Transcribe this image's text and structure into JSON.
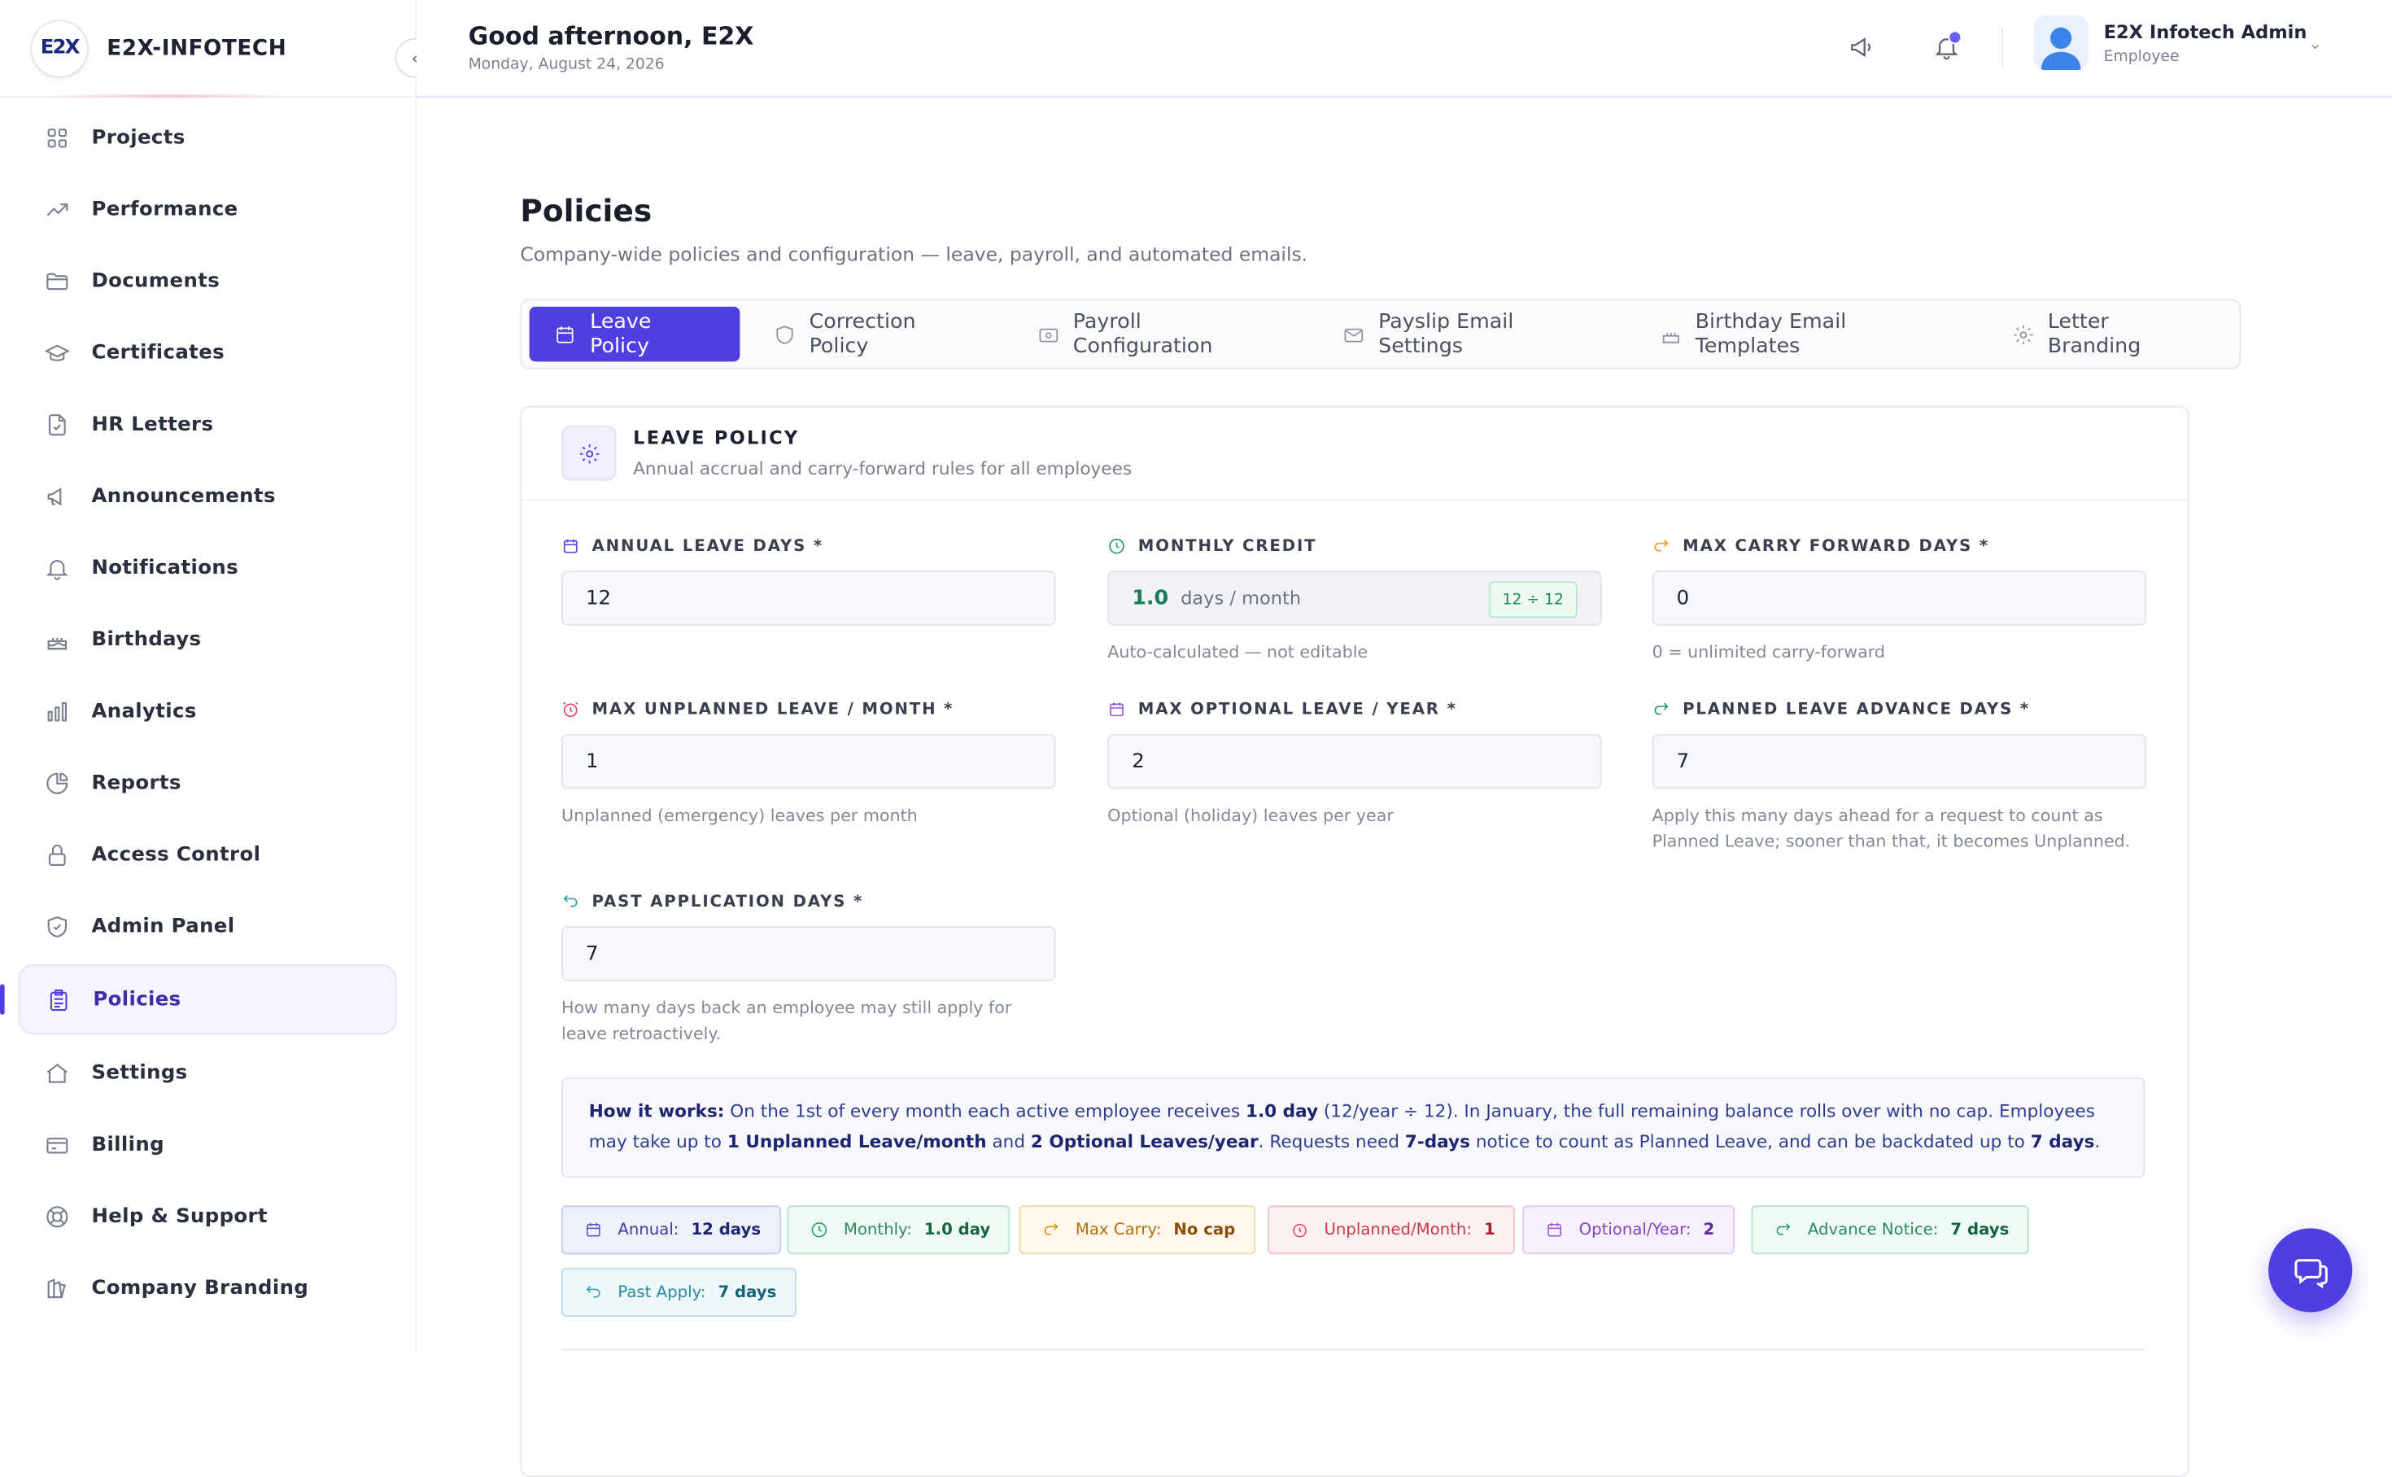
{
  "brand": {
    "name": "E2X-INFOTECH",
    "logo_text": "E2X"
  },
  "sidebar": {
    "items": [
      {
        "label": "Projects",
        "icon": "grid-icon"
      },
      {
        "label": "Performance",
        "icon": "trend-icon"
      },
      {
        "label": "Documents",
        "icon": "folder-icon"
      },
      {
        "label": "Certificates",
        "icon": "graduation-cap-icon"
      },
      {
        "label": "HR Letters",
        "icon": "file-check-icon"
      },
      {
        "label": "Announcements",
        "icon": "megaphone-icon"
      },
      {
        "label": "Notifications",
        "icon": "bell-icon"
      },
      {
        "label": "Birthdays",
        "icon": "cake-icon"
      },
      {
        "label": "Analytics",
        "icon": "bar-chart-icon"
      },
      {
        "label": "Reports",
        "icon": "pie-chart-icon"
      },
      {
        "label": "Access Control",
        "icon": "lock-icon"
      },
      {
        "label": "Admin Panel",
        "icon": "shield-check-icon"
      },
      {
        "label": "Policies",
        "icon": "clipboard-icon",
        "active": true
      },
      {
        "label": "Settings",
        "icon": "home-icon"
      },
      {
        "label": "Billing",
        "icon": "credit-card-icon"
      },
      {
        "label": "Help & Support",
        "icon": "lifebuoy-icon"
      },
      {
        "label": "Company Branding",
        "icon": "palette-icon"
      }
    ]
  },
  "header": {
    "greeting": "Good afternoon, E2X",
    "date": "Monday, August 24, 2026",
    "user_name": "E2X Infotech Admin",
    "user_role": "Employee"
  },
  "page": {
    "title": "Policies",
    "subtitle": "Company-wide policies and configuration — leave, payroll, and automated emails."
  },
  "tabs": [
    {
      "label": "Leave Policy",
      "active": true
    },
    {
      "label": "Correction Policy"
    },
    {
      "label": "Payroll Configuration"
    },
    {
      "label": "Payslip Email Settings"
    },
    {
      "label": "Birthday Email Templates"
    },
    {
      "label": "Letter Branding"
    }
  ],
  "card": {
    "title": "LEAVE POLICY",
    "subtitle": "Annual accrual and carry-forward rules for all employees"
  },
  "fields": {
    "annual": {
      "label": "ANNUAL LEAVE DAYS *",
      "value": "12"
    },
    "monthly": {
      "label": "MONTHLY CREDIT",
      "value": "1.0",
      "unit": "days / month",
      "badge": "12 ÷ 12",
      "hint": "Auto-calculated — not editable"
    },
    "carry": {
      "label": "MAX CARRY FORWARD DAYS *",
      "value": "0",
      "hint": "0 = unlimited carry-forward"
    },
    "unplanned": {
      "label": "MAX UNPLANNED LEAVE / MONTH *",
      "value": "1",
      "hint": "Unplanned (emergency) leaves per month"
    },
    "optional": {
      "label": "MAX OPTIONAL LEAVE / YEAR *",
      "value": "2",
      "hint": "Optional (holiday) leaves per year"
    },
    "advance": {
      "label": "PLANNED LEAVE ADVANCE DAYS *",
      "value": "7",
      "hint": "Apply this many days ahead for a request to count as Planned Leave; sooner than that, it becomes Unplanned."
    },
    "past": {
      "label": "PAST APPLICATION DAYS *",
      "value": "7",
      "hint": "How many days back an employee may still apply for leave retroactively."
    }
  },
  "info": {
    "lead": "How it works:",
    "t1": " On the 1st of every month each active employee receives ",
    "b1": "1.0 day",
    "t2": " (12/year ÷ 12). In January, the full remaining balance rolls over with no cap. Employees may take up to ",
    "b2": "1 Unplanned Leave/month",
    "t3": " and ",
    "b3": "2 Optional Leaves/year",
    "t4": ". Requests need ",
    "b4": "7-days",
    "t5": " notice to count as Planned Leave, and can be backdated up to ",
    "b5": "7 days",
    "t6": "."
  },
  "chips": {
    "annual": {
      "label": "Annual:",
      "value": "12 days"
    },
    "monthly": {
      "label": "Monthly:",
      "value": "1.0 day"
    },
    "carry": {
      "label": "Max Carry:",
      "value": "No cap"
    },
    "unplanned": {
      "label": "Unplanned/Month:",
      "value": "1"
    },
    "optional": {
      "label": "Optional/Year:",
      "value": "2"
    },
    "advance": {
      "label": "Advance Notice:",
      "value": "7 days"
    },
    "past": {
      "label": "Past Apply:",
      "value": "7 days"
    }
  },
  "colors": {
    "accent": "#4f3fe0"
  }
}
